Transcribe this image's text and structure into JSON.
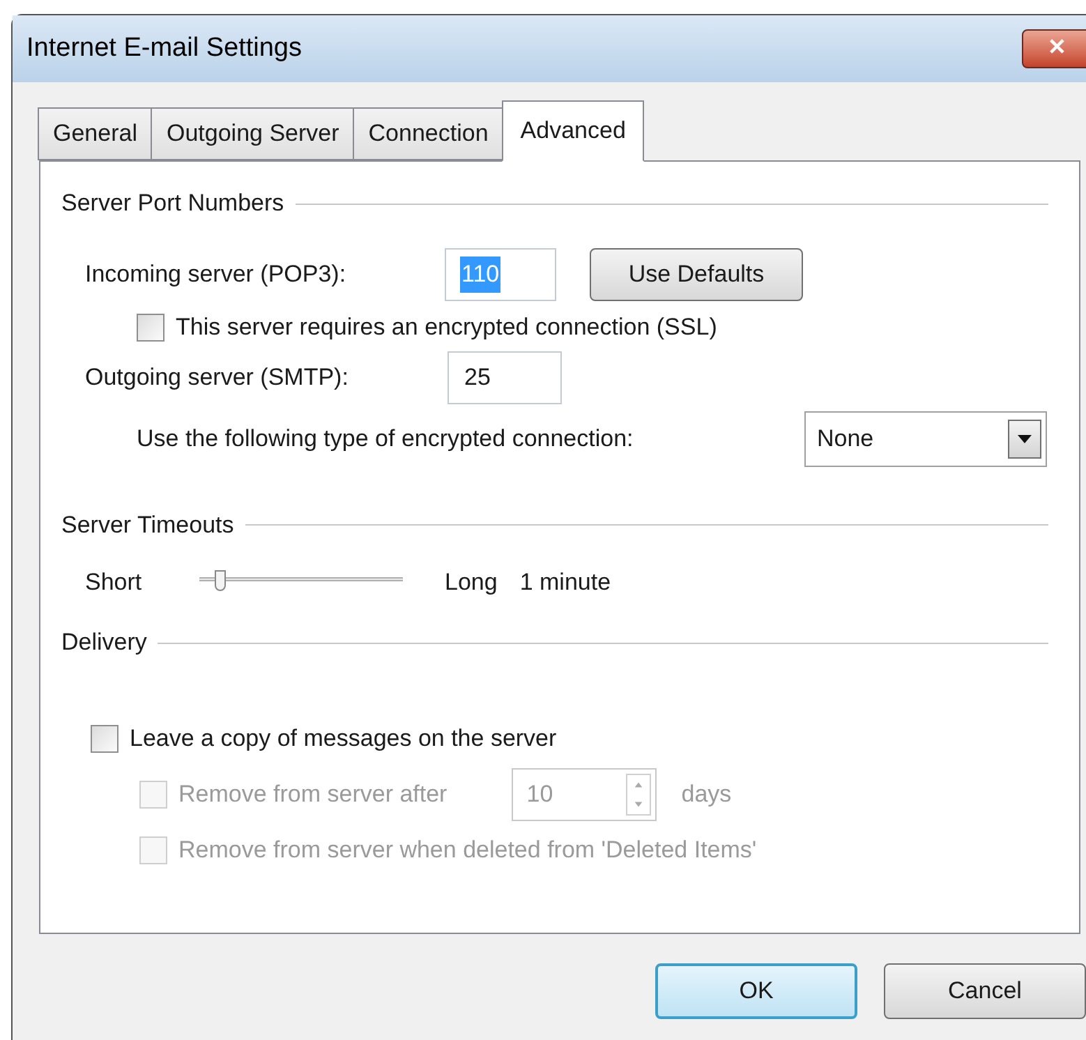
{
  "window": {
    "title": "Internet E-mail Settings",
    "close": "✕"
  },
  "tabs": [
    {
      "label": "General",
      "selected": false
    },
    {
      "label": "Outgoing Server",
      "selected": false
    },
    {
      "label": "Connection",
      "selected": false
    },
    {
      "label": "Advanced",
      "selected": true
    }
  ],
  "server_port_numbers": {
    "heading": "Server Port Numbers",
    "incoming": {
      "label": "Incoming server (POP3):",
      "value": "110",
      "text_selected": true
    },
    "use_defaults": "Use Defaults",
    "ssl": {
      "label": "This server requires an encrypted connection (SSL)",
      "checked": false
    },
    "outgoing": {
      "label": "Outgoing server (SMTP):",
      "value": "25",
      "text_selected": false
    },
    "encryption": {
      "label": "Use the following type of encrypted connection:",
      "value": "None"
    }
  },
  "server_timeouts": {
    "heading": "Server Timeouts",
    "min_label": "Short",
    "max_label": "Long",
    "reading": "1 minute",
    "level": 0.08
  },
  "delivery": {
    "heading": "Delivery",
    "options": [
      {
        "kind": "checkbox",
        "label": "Leave a copy of messages on the server",
        "checked": false,
        "disabled": false
      },
      {
        "kind": "spinner",
        "label": "Remove from server after",
        "checked": false,
        "disabled": true,
        "value": "10",
        "unit": "days"
      },
      {
        "kind": "checkbox",
        "label": "Remove from server when deleted from 'Deleted Items'",
        "checked": false,
        "disabled": true
      }
    ]
  },
  "buttons": [
    {
      "label": "OK",
      "default": true
    },
    {
      "label": "Cancel",
      "default": false
    }
  ]
}
